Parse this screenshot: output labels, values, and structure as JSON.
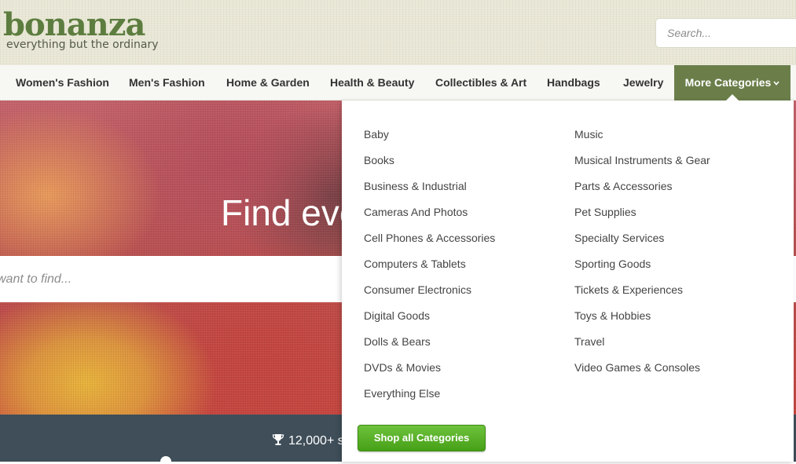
{
  "header": {
    "logo": "bonanza",
    "tagline": "everything but the ordinary",
    "search_placeholder": "Search..."
  },
  "nav": {
    "items": [
      "Women's Fashion",
      "Men's Fashion",
      "Home & Garden",
      "Health & Beauty",
      "Collectibles & Art",
      "Handbags",
      "Jewelry"
    ],
    "more_label": "More Categories",
    "more_icon": "chevron-down-icon"
  },
  "hero": {
    "title": "Find eve",
    "search_placeholder": "want to find..."
  },
  "band": {
    "stat": "12,000+ s",
    "stat_icon": "trophy-icon"
  },
  "dropdown": {
    "column1": [
      "Baby",
      "Books",
      "Business & Industrial",
      "Cameras And Photos",
      "Cell Phones & Accessories",
      "Computers & Tablets",
      "Consumer Electronics",
      "Digital Goods",
      "Dolls & Bears",
      "DVDs & Movies",
      "Everything Else"
    ],
    "column2": [
      "Music",
      "Musical Instruments & Gear",
      "Parts & Accessories",
      "Pet Supplies",
      "Specialty Services",
      "Sporting Goods",
      "Tickets & Experiences",
      "Toys & Hobbies",
      "Travel",
      "Video Games & Consoles"
    ],
    "shop_all_label": "Shop all Categories"
  },
  "colors": {
    "brand_green": "#5c7d3f",
    "nav_active": "#6b7e4a",
    "button_green": "#46a017",
    "band": "#3f4e59"
  }
}
